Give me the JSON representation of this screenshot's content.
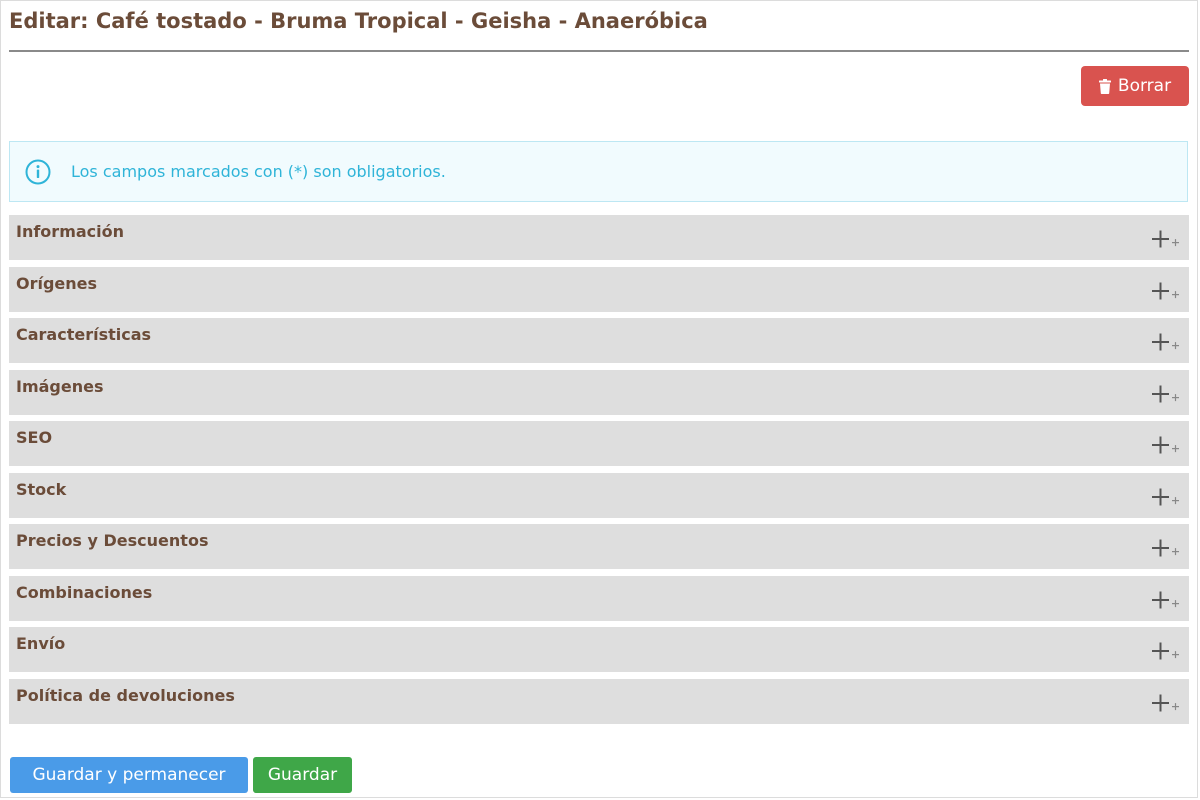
{
  "header": {
    "title": "Editar: Café tostado - Bruma Tropical - Geisha - Anaeróbica"
  },
  "toolbar": {
    "delete_label": "Borrar",
    "delete_icon": "trash-icon"
  },
  "alert": {
    "icon": "info-icon",
    "text": "Los campos marcados con (*) son obligatorios."
  },
  "sections": [
    {
      "label": "Información",
      "icon": "plus-icon"
    },
    {
      "label": "Orígenes",
      "icon": "plus-icon"
    },
    {
      "label": "Características",
      "icon": "plus-icon"
    },
    {
      "label": "Imágenes",
      "icon": "plus-icon"
    },
    {
      "label": "SEO",
      "icon": "plus-icon"
    },
    {
      "label": "Stock",
      "icon": "plus-icon"
    },
    {
      "label": "Precios y Descuentos",
      "icon": "plus-icon"
    },
    {
      "label": "Combinaciones",
      "icon": "plus-icon"
    },
    {
      "label": "Envío",
      "icon": "plus-icon"
    },
    {
      "label": "Política de devoluciones",
      "icon": "plus-icon"
    }
  ],
  "footer": {
    "save_stay_label": "Guardar y permanecer",
    "save_label": "Guardar"
  },
  "colors": {
    "title_brown": "#6b4c39",
    "danger": "#d9534f",
    "info": "#2fb4d8",
    "primary": "#4a9be8",
    "success": "#3fa748",
    "section_bg": "#dedede"
  }
}
